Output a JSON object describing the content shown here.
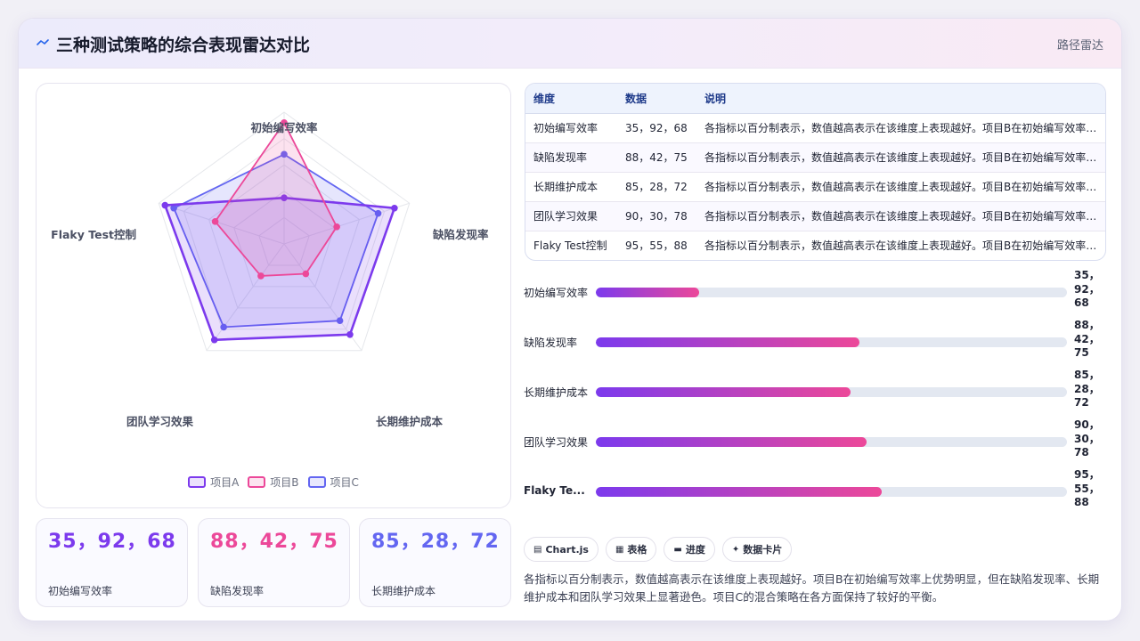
{
  "header": {
    "title": "三种测试策略的综合表现雷达对比",
    "tag": "路径雷达"
  },
  "chart_data": {
    "type": "radar",
    "indicators": [
      "初始编写效率",
      "缺陷发现率",
      "长期维护成本",
      "团队学习效果",
      "Flaky Test控制"
    ],
    "max": 100,
    "series": [
      {
        "name": "项目A",
        "values": [
          35,
          88,
          85,
          90,
          95
        ],
        "color": "#7c3aed"
      },
      {
        "name": "项目B",
        "values": [
          92,
          42,
          28,
          30,
          55
        ],
        "color": "#ec4899"
      },
      {
        "name": "项目C",
        "values": [
          68,
          75,
          72,
          78,
          88
        ],
        "color": "#6366f1"
      }
    ],
    "legend_position": "bottom-center"
  },
  "stats": [
    {
      "value": "35，92，68",
      "label": "初始编写效率",
      "color": "#7c3aed"
    },
    {
      "value": "88，42，75",
      "label": "缺陷发现率",
      "color": "#ec4899"
    },
    {
      "value": "85，28，72",
      "label": "长期维护成本",
      "color": "#6366f1"
    }
  ],
  "table": {
    "headers": [
      "维度",
      "数据",
      "说明"
    ],
    "rows": [
      {
        "dim": "初始编写效率",
        "data": "35，92，68",
        "note": "各指标以百分制表示，数值越高表示在该维度上表现越好。项目B在初始编写效率上优势明显"
      },
      {
        "dim": "缺陷发现率",
        "data": "88，42，75",
        "note": "各指标以百分制表示，数值越高表示在该维度上表现越好。项目B在初始编写效率上优势明显"
      },
      {
        "dim": "长期维护成本",
        "data": "85，28，72",
        "note": "各指标以百分制表示，数值越高表示在该维度上表现越好。项目B在初始编写效率上优势明显"
      },
      {
        "dim": "团队学习效果",
        "data": "90，30，78",
        "note": "各指标以百分制表示，数值越高表示在该维度上表现越好。项目B在初始编写效率上优势明显"
      },
      {
        "dim": "Flaky Test控制",
        "data": "95，55，88",
        "note": "各指标以百分制表示，数值越高表示在该维度上表现越好。项目B在初始编写效率上优势明显"
      }
    ]
  },
  "bars": [
    {
      "label": "初始编写效率",
      "value": "35，92，68",
      "progress": 0.22
    },
    {
      "label": "缺陷发现率",
      "value": "88，42，75",
      "progress": 0.56
    },
    {
      "label": "长期维护成本",
      "value": "85，28，72",
      "progress": 0.54
    },
    {
      "label": "团队学习效果",
      "value": "90，30，78",
      "progress": 0.574
    },
    {
      "label": "Flaky Te...",
      "value": "95，55，88",
      "progress": 0.607
    }
  ],
  "chips": [
    {
      "icon": "▤",
      "label": "Chart.js"
    },
    {
      "icon": "▦",
      "label": "表格"
    },
    {
      "icon": "▬",
      "label": "进度"
    },
    {
      "icon": "✦",
      "label": "数据卡片"
    }
  ],
  "description": "各指标以百分制表示，数值越高表示在该维度上表现越好。项目B在初始编写效率上优势明显，但在缺陷发现率、长期维护成本和团队学习效果上显著逊色。项目C的混合策略在各方面保持了较好的平衡。"
}
